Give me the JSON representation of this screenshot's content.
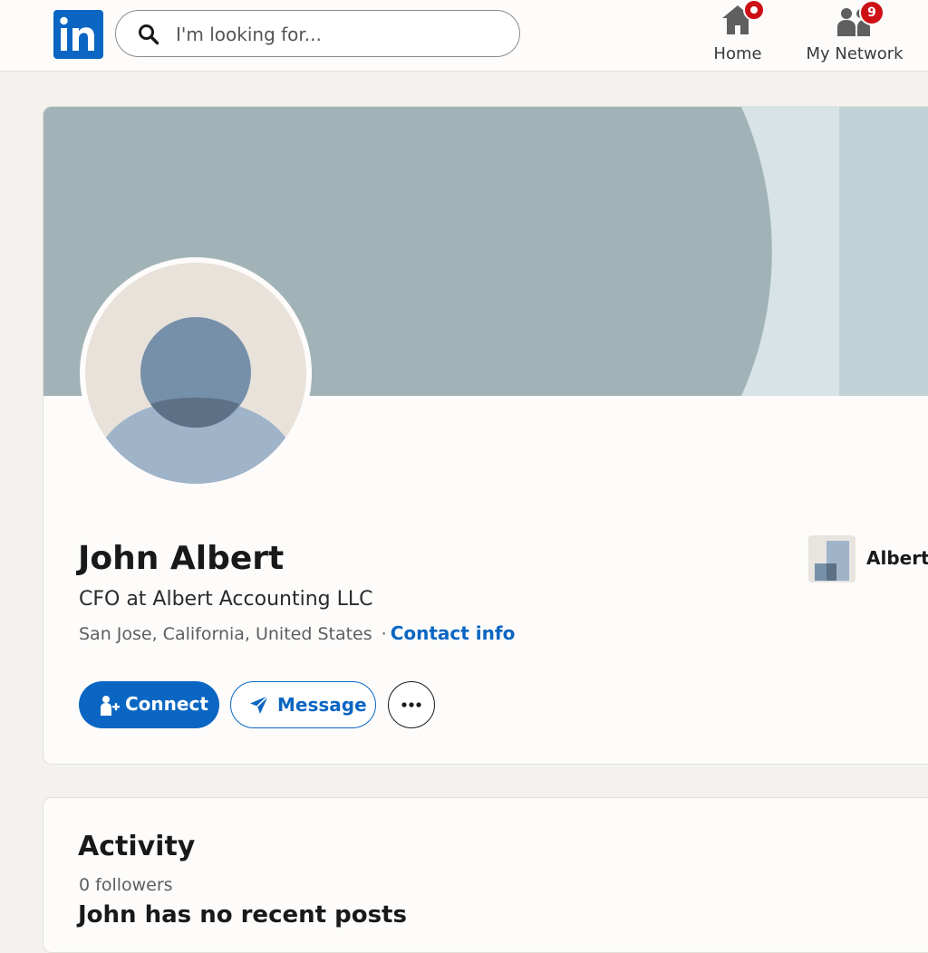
{
  "header": {
    "logo_text": "in",
    "search": {
      "placeholder": "I'm looking for..."
    },
    "nav": [
      {
        "label": "Home",
        "icon": "home-icon",
        "badge": ""
      },
      {
        "label": "My Network",
        "icon": "network-icon",
        "badge": "9"
      }
    ]
  },
  "profile": {
    "name": "John Albert",
    "headline": "CFO at Albert Accounting LLC",
    "location": "San Jose, California, United States",
    "separator": "·",
    "contact_label": "Contact info",
    "company_name": "Albert",
    "actions": {
      "connect_label": "Connect",
      "message_label": "Message"
    }
  },
  "activity": {
    "title": "Activity",
    "followers": "0 followers",
    "empty_message": "John has no recent posts"
  },
  "colors": {
    "brand": "#0a66c2",
    "badge": "#cc1016",
    "cover": "#a1b3b6"
  }
}
